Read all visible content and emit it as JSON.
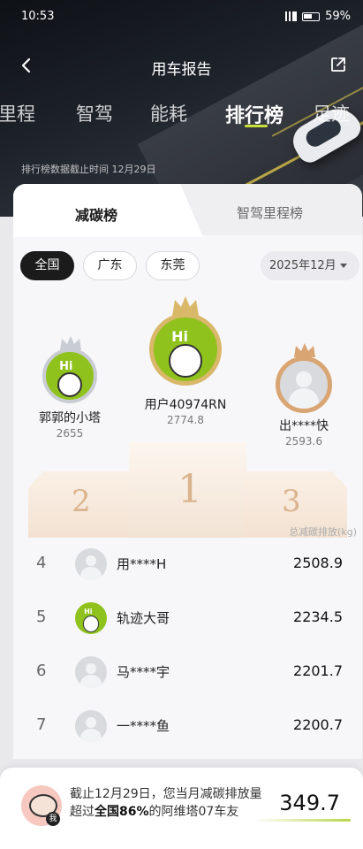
{
  "status": {
    "time": "10:53",
    "battery": "59%"
  },
  "nav": {
    "title": "用车报告"
  },
  "hero_tabs": [
    "里程",
    "智驾",
    "能耗",
    "排行榜",
    "足迹"
  ],
  "hero_note": "排行榜数据截止时间 12月29日",
  "card_tabs": {
    "active": "减碳榜",
    "inactive": "智驾里程榜"
  },
  "filters": {
    "chips": [
      "全国",
      "广东",
      "东莞"
    ],
    "month": "2025年12月"
  },
  "podium": {
    "first": {
      "name": "用户40974RN",
      "value": "2774.8",
      "rank": "1"
    },
    "second": {
      "name": "郭郭的小塔",
      "value": "2655",
      "rank": "2"
    },
    "third": {
      "name": "出****快",
      "value": "2593.6",
      "rank": "3"
    }
  },
  "unit_label": "总减碳排放(kg)",
  "rows": [
    {
      "rank": "4",
      "name": "用****H",
      "value": "2508.9"
    },
    {
      "rank": "5",
      "name": "轨迹大哥",
      "value": "2234.5"
    },
    {
      "rank": "6",
      "name": "马****宇",
      "value": "2201.7"
    },
    {
      "rank": "7",
      "name": "一****鱼",
      "value": "2200.7"
    }
  ],
  "summary": {
    "pre": "截止12月29日，您当月减碳排放量超过",
    "highlight": "全国86%",
    "post": "的阿维塔07车友",
    "value": "349.7",
    "badge": "我"
  },
  "avatar_text": "Hi",
  "colors": {
    "accent": "#c8e03a",
    "hi_green": "#8fc21d",
    "gold": "#d9b86a"
  }
}
